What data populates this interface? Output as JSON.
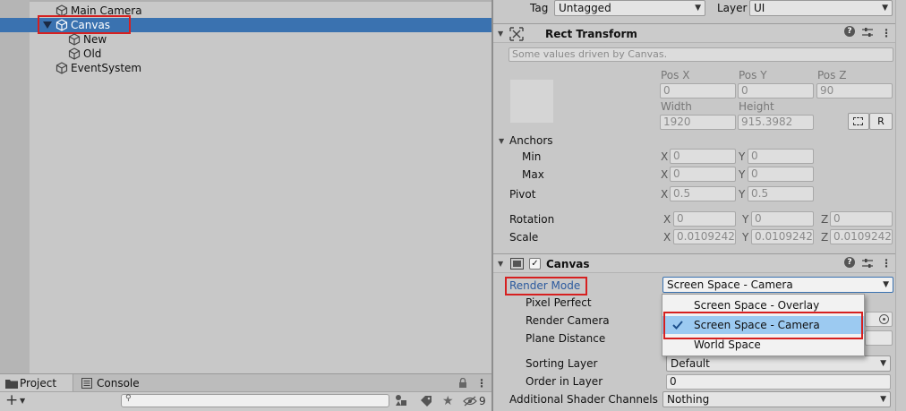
{
  "hierarchy": {
    "items": [
      {
        "label": "Main Camera"
      },
      {
        "label": "Canvas"
      },
      {
        "label": "New"
      },
      {
        "label": "Old"
      },
      {
        "label": "EventSystem"
      }
    ]
  },
  "project": {
    "tabs": [
      {
        "label": "Project"
      },
      {
        "label": "Console"
      }
    ],
    "hidden_count": "9",
    "search_placeholder": ""
  },
  "inspector": {
    "tag_label": "Tag",
    "tag_value": "Untagged",
    "layer_label": "Layer",
    "layer_value": "UI",
    "rect_transform": {
      "title": "Rect Transform",
      "note": "Some values driven by Canvas.",
      "pos_x_label": "Pos X",
      "pos_y_label": "Pos Y",
      "pos_z_label": "Pos Z",
      "pos_x": "0",
      "pos_y": "0",
      "pos_z": "90",
      "width_label": "Width",
      "height_label": "Height",
      "width": "1920",
      "height": "915.3982",
      "r_button": "R",
      "anchors_label": "Anchors",
      "min_label": "Min",
      "max_label": "Max",
      "min_x": "0",
      "min_y": "0",
      "max_x": "0",
      "max_y": "0",
      "pivot_label": "Pivot",
      "pivot_x": "0.5",
      "pivot_y": "0.5",
      "rotation_label": "Rotation",
      "rot_x": "0",
      "rot_y": "0",
      "rot_z": "0",
      "scale_label": "Scale",
      "scale_x": "0.0109242",
      "scale_y": "0.0109242",
      "scale_z": "0.0109242",
      "x": "X",
      "y": "Y",
      "z": "Z"
    },
    "canvas": {
      "title": "Canvas",
      "render_mode_label": "Render Mode",
      "render_mode_value": "Screen Space - Camera",
      "pixel_perfect_label": "Pixel Perfect",
      "render_camera_label": "Render Camera",
      "plane_distance_label": "Plane Distance",
      "sorting_layer_label": "Sorting Layer",
      "sorting_layer_value": "Default",
      "order_in_layer_label": "Order in Layer",
      "order_in_layer_value": "0",
      "shader_channels_label": "Additional Shader Channels",
      "shader_channels_value": "Nothing"
    },
    "render_mode_menu": {
      "options": [
        {
          "label": "Screen Space - Overlay",
          "selected": false
        },
        {
          "label": "Screen Space - Camera",
          "selected": true
        },
        {
          "label": "World Space",
          "selected": false
        }
      ]
    }
  },
  "colors": {
    "selection": "#3a72b0",
    "highlight_box": "#d62020",
    "menu_highlight": "#9ccaf1",
    "label_link": "#2c5a9e"
  }
}
